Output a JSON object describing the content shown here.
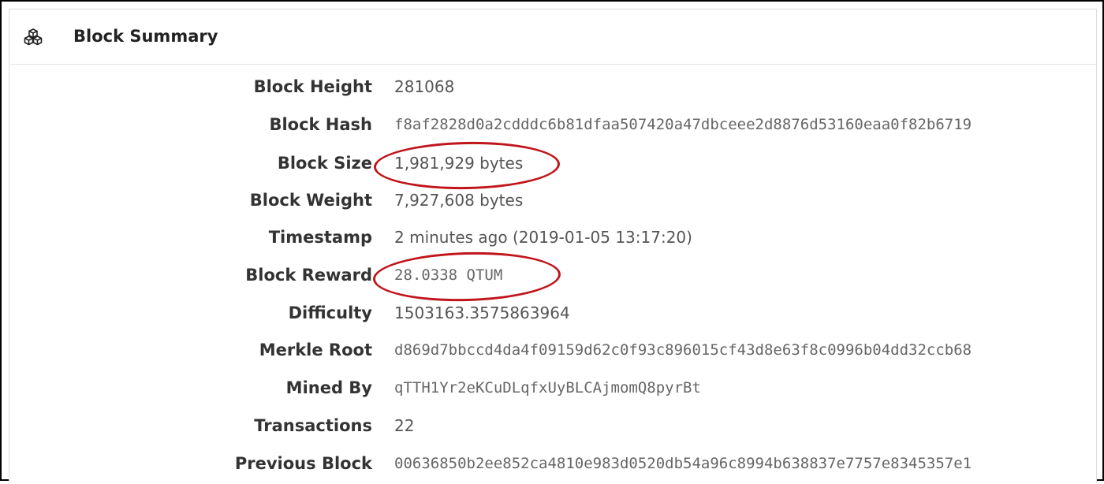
{
  "header": {
    "title": "Block Summary",
    "icon": "cubes-icon"
  },
  "rows": [
    {
      "label": "Block Height",
      "value": "281068"
    },
    {
      "label": "Block Hash",
      "value": "f8af2828d0a2cdddc6b81dfaa507420a47dbceee2d8876d53160eaa0f82b6719"
    },
    {
      "label": "Block Size",
      "value": "1,981,929 bytes"
    },
    {
      "label": "Block Weight",
      "value": "7,927,608 bytes"
    },
    {
      "label": "Timestamp",
      "value": "2 minutes ago (2019-01-05 13:17:20)"
    },
    {
      "label": "Block Reward",
      "value": "28.0338 QTUM"
    },
    {
      "label": "Difficulty",
      "value": "1503163.3575863964"
    },
    {
      "label": "Merkle Root",
      "value": "d869d7bbccd4da4f09159d62c0f93c896015cf43d8e63f8c0996b04dd32ccb68"
    },
    {
      "label": "Mined By",
      "value": "qTTH1Yr2eKCuDLqfxUyBLCAjmomQ8pyrBt"
    },
    {
      "label": "Transactions",
      "value": "22"
    },
    {
      "label": "Previous Block",
      "value": "00636850b2ee852ca4810e983d0520db54a96c8994b638837e7757e8345357e1"
    }
  ],
  "annotation_color": "#c0151b"
}
